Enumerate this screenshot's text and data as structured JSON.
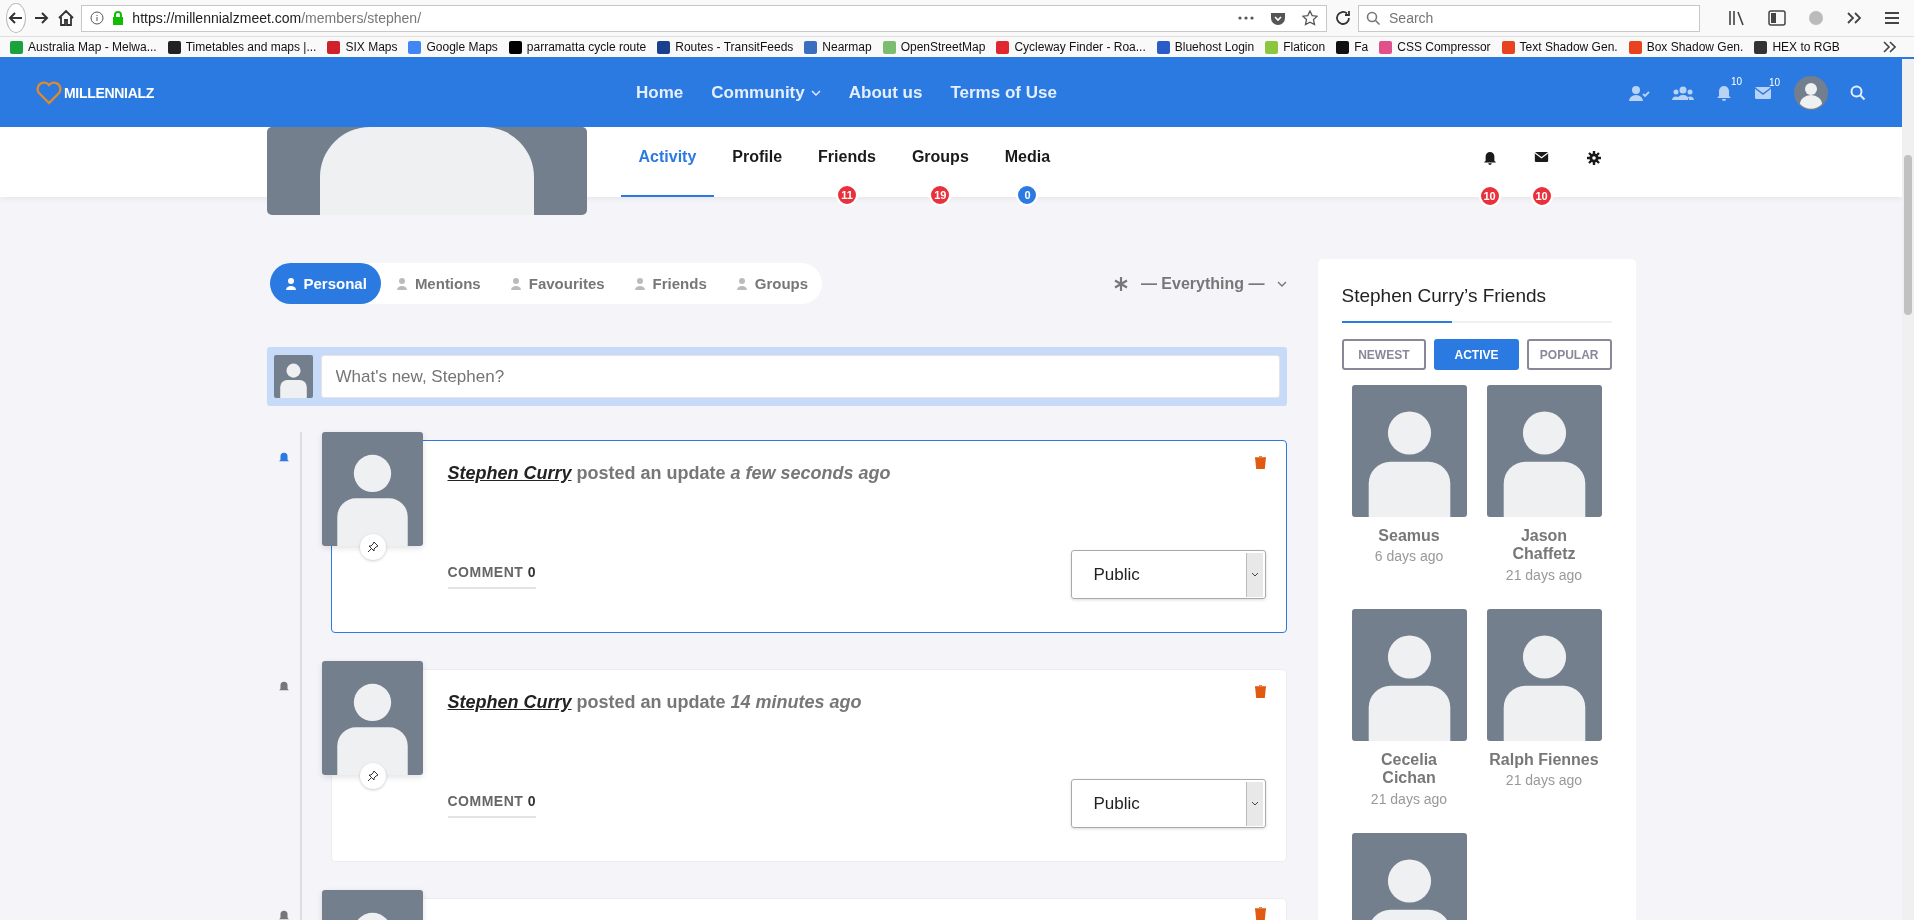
{
  "browser": {
    "url_host": "https://millennialzmeet.com",
    "url_path": "/members/stephen/",
    "search_placeholder": "Search",
    "bookmarks": [
      {
        "label": "Australia Map - Melwa...",
        "color": "#1aa33a"
      },
      {
        "label": "Timetables and maps |...",
        "color": "#222222"
      },
      {
        "label": "SIX Maps",
        "color": "#d0202a"
      },
      {
        "label": "Google Maps",
        "color": "#4285f4"
      },
      {
        "label": "parramatta cycle route",
        "color": "#000000"
      },
      {
        "label": "Routes - TransitFeeds",
        "color": "#1a3f8c"
      },
      {
        "label": "Nearmap",
        "color": "#3a6fc0"
      },
      {
        "label": "OpenStreetMap",
        "color": "#7ebc6f"
      },
      {
        "label": "Cycleway Finder - Roa...",
        "color": "#e0262e"
      },
      {
        "label": "Bluehost Login",
        "color": "#2a5cc8"
      },
      {
        "label": "Flaticon",
        "color": "#8cc63f"
      },
      {
        "label": "Fa",
        "color": "#111111"
      },
      {
        "label": "CSS Compressor",
        "color": "#e0508a"
      },
      {
        "label": "Text Shadow Gen.",
        "color": "#e8421f"
      },
      {
        "label": "Box Shadow Gen.",
        "color": "#e8421f"
      },
      {
        "label": "HEX to RGB",
        "color": "#333333"
      }
    ]
  },
  "site_nav": {
    "logo": "MILLENNIALZ",
    "menu": [
      {
        "label": "Home",
        "dropdown": false
      },
      {
        "label": "Community",
        "dropdown": true
      },
      {
        "label": "About us",
        "dropdown": false
      },
      {
        "label": "Terms of Use",
        "dropdown": false
      }
    ],
    "notifications_count": "10",
    "messages_count": "10"
  },
  "profile_tabs": [
    {
      "label": "Activity",
      "selected": true
    },
    {
      "label": "Profile",
      "selected": false
    },
    {
      "label": "Friends",
      "selected": false,
      "count": "11",
      "color": "#e8313c"
    },
    {
      "label": "Groups",
      "selected": false,
      "count": "19",
      "color": "#e8313c"
    },
    {
      "label": "Media",
      "selected": false,
      "count": "0",
      "color": "#2a7ae2"
    }
  ],
  "profile_actions": {
    "notifications_count": "10",
    "messages_count": "10"
  },
  "activity_filters": [
    {
      "label": "Personal",
      "selected": true
    },
    {
      "label": "Mentions",
      "selected": false
    },
    {
      "label": "Favourites",
      "selected": false
    },
    {
      "label": "Friends",
      "selected": false
    },
    {
      "label": "Groups",
      "selected": false
    }
  ],
  "show_filter": "— Everything —",
  "post_box": {
    "placeholder": "What's new, Stephen?"
  },
  "posts": [
    {
      "kind": "full",
      "author": "Stephen Curry",
      "action": "posted an update",
      "time": "a few seconds ago",
      "comment_label": "COMMENT",
      "comment_count": "0",
      "privacy": "Public",
      "highlighted": true
    },
    {
      "kind": "full",
      "author": "Stephen Curry",
      "action": "posted an update",
      "time": "14 minutes ago",
      "comment_label": "COMMENT",
      "comment_count": "0",
      "privacy": "Public",
      "highlighted": false
    },
    {
      "kind": "partial"
    }
  ],
  "sidebar": {
    "title": "Stephen Curry’s Friends",
    "filters": [
      {
        "label": "NEWEST",
        "selected": false
      },
      {
        "label": "ACTIVE",
        "selected": true
      },
      {
        "label": "POPULAR",
        "selected": false
      }
    ],
    "friends": [
      {
        "kind": "full",
        "name": "Seamus",
        "last_active": "6 days ago"
      },
      {
        "kind": "full",
        "name": "Jason Chaffetz",
        "last_active": "21 days ago"
      },
      {
        "kind": "full",
        "name": "Cecelia Cichan",
        "last_active": "21 days ago"
      },
      {
        "kind": "full",
        "name": "Ralph Fiennes",
        "last_active": "21 days ago"
      },
      {
        "kind": "avatar_only"
      }
    ]
  }
}
